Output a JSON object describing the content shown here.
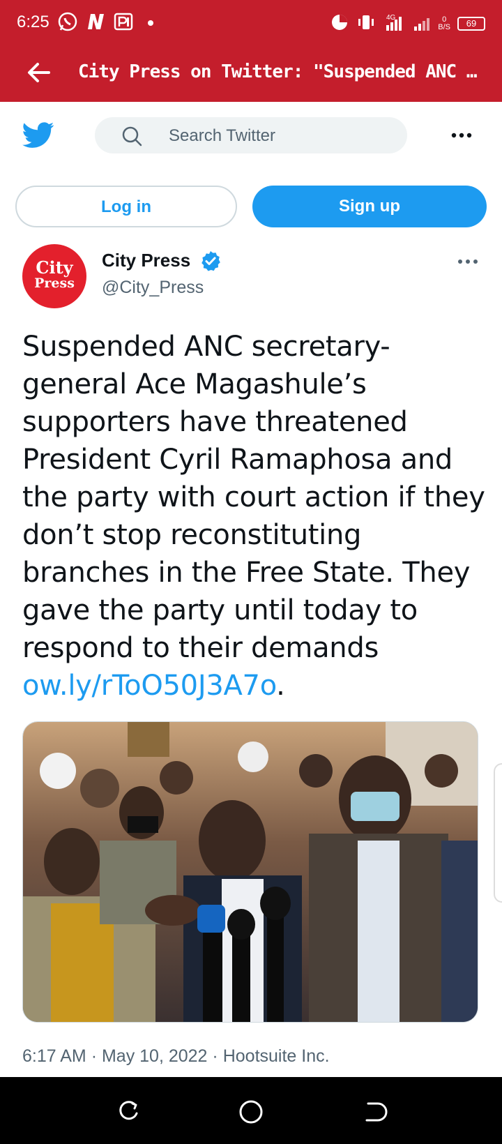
{
  "status_bar": {
    "time": "6:25",
    "network": "4G",
    "data_speed_value": "0",
    "data_speed_unit": "B/S",
    "battery": "69"
  },
  "header": {
    "title": "City Press on Twitter: \"Suspended ANC sec..."
  },
  "twitter_bar": {
    "search_placeholder": "Search Twitter"
  },
  "auth": {
    "login_label": "Log in",
    "signup_label": "Sign up"
  },
  "tweet": {
    "avatar_text_line1": "City",
    "avatar_text_line2": "Press",
    "author_name": "City Press",
    "handle": "@City_Press",
    "text": "Suspended ANC secretary-general Ace Magashule’s supporters have threatened President Cyril Ramaphosa and the party with court action if they don’t stop reconstituting branches in the Free State. They gave the party until today to respond to their demands ",
    "link": "ow.ly/rToO50J3A7o",
    "text_end": ".",
    "time": "6:17 AM",
    "date": "May 10, 2022",
    "source": "Hootsuite Inc.",
    "separator": "·"
  },
  "colors": {
    "app_bar": "#c41e2c",
    "twitter_blue": "#1d9bf0",
    "avatar_red": "#e3202c"
  },
  "icons": [
    "back-arrow-icon",
    "twitter-bird-icon",
    "search-icon",
    "more-icon",
    "verified-badge-icon",
    "recent-apps-icon",
    "home-icon",
    "back-icon"
  ]
}
